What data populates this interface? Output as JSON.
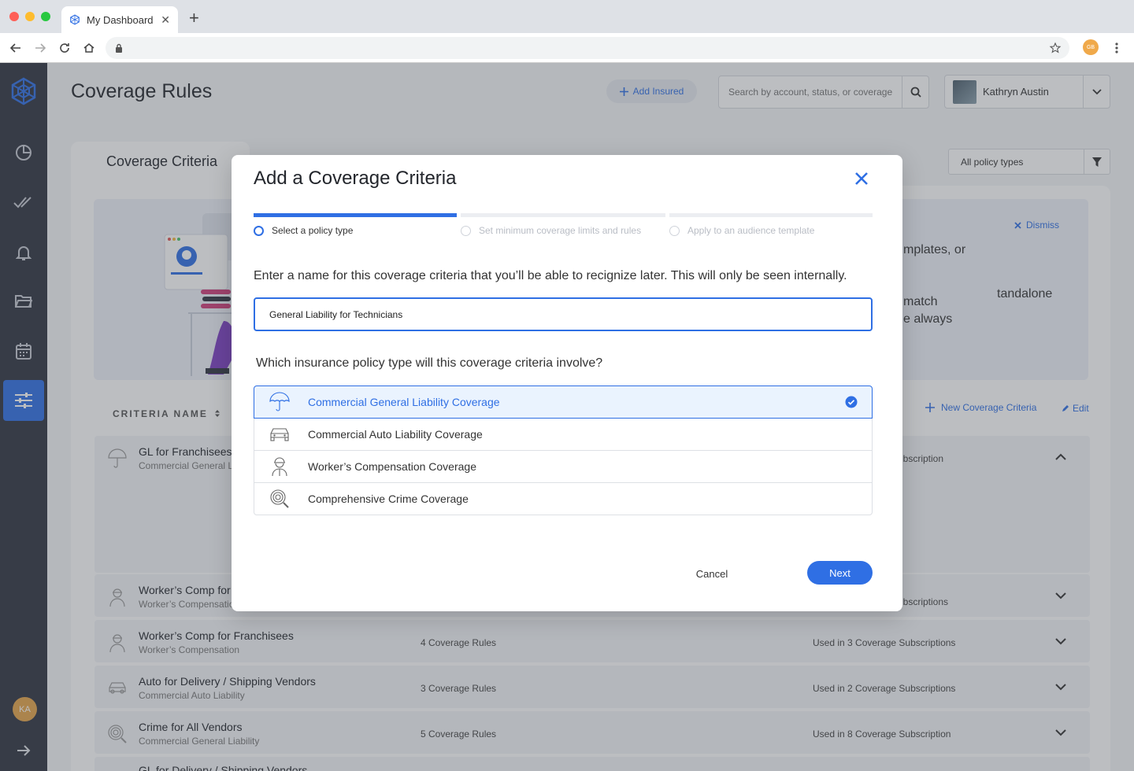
{
  "browser": {
    "tab_title": "My Dashboard",
    "profile_initials": "GB"
  },
  "header": {
    "page_title": "Coverage Rules",
    "add_insured_label": "Add Insured",
    "search_placeholder": "Search by account, status, or coverage",
    "user_name": "Kathryn Austin"
  },
  "sidebar": {
    "avatar_initials": "KA",
    "items": [
      "dashboard-icon",
      "check-icon",
      "bell-icon",
      "folder-icon",
      "calendar-icon",
      "sliders-icon"
    ]
  },
  "card": {
    "tab_label": "Coverage Criteria",
    "policy_filter_label": "All policy types",
    "banner_lines": [
      "tandalone",
      "mplates, or",
      "match",
      "e always"
    ],
    "dismiss_label": "Dismiss",
    "column_header": "CRITERIA NAME",
    "new_criteria_label": "New Coverage Criteria",
    "edit_label": "Edit"
  },
  "rows": [
    {
      "title": "GL for Franchisees",
      "subtitle": "Commercial General L",
      "rules": "",
      "used": "ubscription"
    },
    {
      "title": "Worker’s Comp for",
      "subtitle": "Worker’s Compensatio",
      "rules": "",
      "used": "ubscriptions"
    },
    {
      "title": "Worker’s Comp for Franchisees",
      "subtitle": "Worker’s Compensation",
      "rules": "4 Coverage Rules",
      "used": "Used in 3 Coverage Subscriptions"
    },
    {
      "title": "Auto for Delivery / Shipping Vendors",
      "subtitle": "Commercial Auto Liability",
      "rules": "3 Coverage Rules",
      "used": "Used in 2 Coverage Subscriptions"
    },
    {
      "title": "Crime for All Vendors",
      "subtitle": "Commercial General Liability",
      "rules": "5 Coverage Rules",
      "used": "Used in 8 Coverage Subscription"
    },
    {
      "title": "GL for Delivery / Shipping Vendors",
      "subtitle": "",
      "rules": "",
      "used": ""
    }
  ],
  "modal": {
    "title": "Add a Coverage Criteria",
    "steps": [
      {
        "label": "Select a policy type",
        "active": true
      },
      {
        "label": "Set minimum coverage limits and rules",
        "active": false
      },
      {
        "label": "Apply to an audience template",
        "active": false
      }
    ],
    "name_prompt": "Enter a name for this coverage criteria that you’ll be able to recignize later. This will only be seen internally.",
    "name_value": "General Liability for Technicians",
    "question": "Which insurance policy type will this coverage criteria involve?",
    "options": [
      {
        "label": "Commercial General Liability Coverage",
        "icon": "umbrella-icon",
        "selected": true
      },
      {
        "label": "Commercial Auto Liability Coverage",
        "icon": "car-icon",
        "selected": false
      },
      {
        "label": "Worker’s Compensation Coverage",
        "icon": "worker-icon",
        "selected": false
      },
      {
        "label": "Comprehensive Crime Coverage",
        "icon": "fingerprint-icon",
        "selected": false
      }
    ],
    "cancel_label": "Cancel",
    "next_label": "Next"
  },
  "colors": {
    "accent": "#2f6fe4",
    "sidebar": "#2f3441",
    "selected_option_bg": "#eaf3fe"
  }
}
